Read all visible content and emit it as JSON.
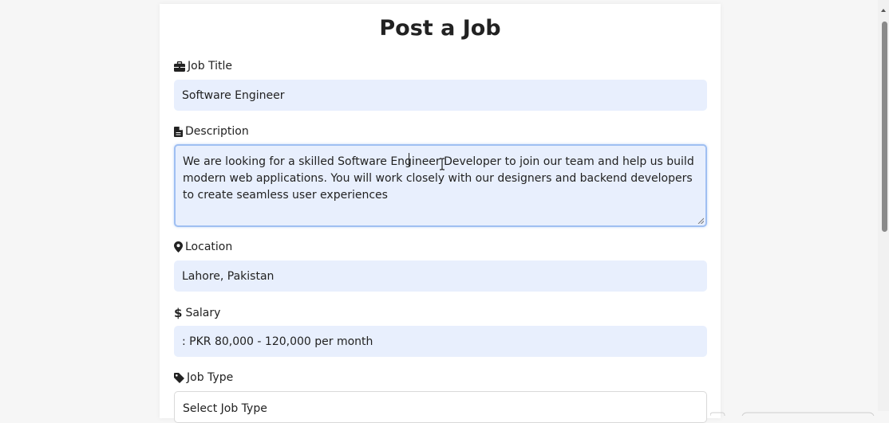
{
  "form": {
    "title": "Post a Job",
    "fields": {
      "job_title": {
        "label": "Job Title",
        "icon": "briefcase-icon",
        "value": "Software Engineer"
      },
      "description": {
        "label": "Description",
        "icon": "file-icon",
        "value_before_caret": "We are looking for a skilled Software Engineer",
        "value_after_caret": " Developer to join our team and help us build modern web applications. You will work closely with our designers and backend developers to create seamless user experiences"
      },
      "location": {
        "label": "Location",
        "icon": "map-marker-icon",
        "value": "Lahore, Pakistan"
      },
      "salary": {
        "label": "Salary",
        "icon": "dollar-icon",
        "value": ": PKR 80,000 - 120,000 per month"
      },
      "job_type": {
        "label": "Job Type",
        "icon": "tag-icon",
        "value": "Select Job Type"
      }
    }
  },
  "colors": {
    "input_bg": "#e8effd",
    "focus_border": "#9fbff2",
    "card_bg": "#ffffff",
    "page_bg": "#f6f6f6"
  }
}
